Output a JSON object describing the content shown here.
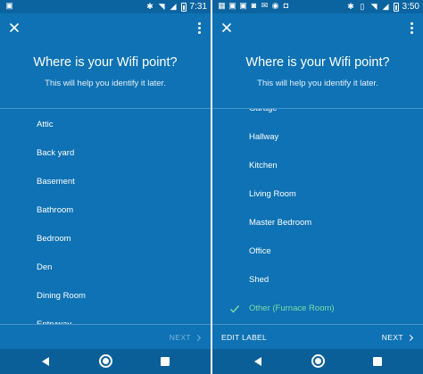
{
  "left": {
    "status": {
      "time": "7:31",
      "notification_icons": [
        "image-icon"
      ],
      "system_icons": [
        "bluetooth-icon",
        "wifi-icon",
        "signal-icon",
        "battery-icon"
      ]
    },
    "title": "Where is your Wifi point?",
    "subtitle": "This will help you identify it later.",
    "items": [
      {
        "label": "Attic",
        "selected": false
      },
      {
        "label": "Back yard",
        "selected": false
      },
      {
        "label": "Basement",
        "selected": false
      },
      {
        "label": "Bathroom",
        "selected": false
      },
      {
        "label": "Bedroom",
        "selected": false
      },
      {
        "label": "Den",
        "selected": false
      },
      {
        "label": "Dining Room",
        "selected": false
      },
      {
        "label": "Entryway",
        "selected": false
      }
    ],
    "next_label": "NEXT",
    "next_enabled": false
  },
  "right": {
    "status": {
      "time": "3:50",
      "notification_icons": [
        "calendar-icon",
        "image-icon",
        "image-icon",
        "gamepad-icon",
        "mail-icon",
        "skype-icon",
        "outlook-icon"
      ],
      "system_icons": [
        "bluetooth-icon",
        "vibrate-icon",
        "wifi-icon",
        "signal-icon",
        "battery-icon"
      ]
    },
    "title": "Where is your Wifi point?",
    "subtitle": "This will help you identify it later.",
    "items": [
      {
        "label": "Garage",
        "selected": false
      },
      {
        "label": "Hallway",
        "selected": false
      },
      {
        "label": "Kitchen",
        "selected": false
      },
      {
        "label": "Living Room",
        "selected": false
      },
      {
        "label": "Master Bedroom",
        "selected": false
      },
      {
        "label": "Office",
        "selected": false
      },
      {
        "label": "Shed",
        "selected": false
      },
      {
        "label": "Other (Furnace Room)",
        "selected": true
      }
    ],
    "edit_label": "EDIT LABEL",
    "next_label": "NEXT",
    "next_enabled": true
  },
  "colors": {
    "background": "#0e72b4",
    "status_bar": "#0b64a0",
    "nav_bar": "#0a5f99",
    "selected_accent": "#7fdca8",
    "disabled_text": "#7db3d8"
  }
}
